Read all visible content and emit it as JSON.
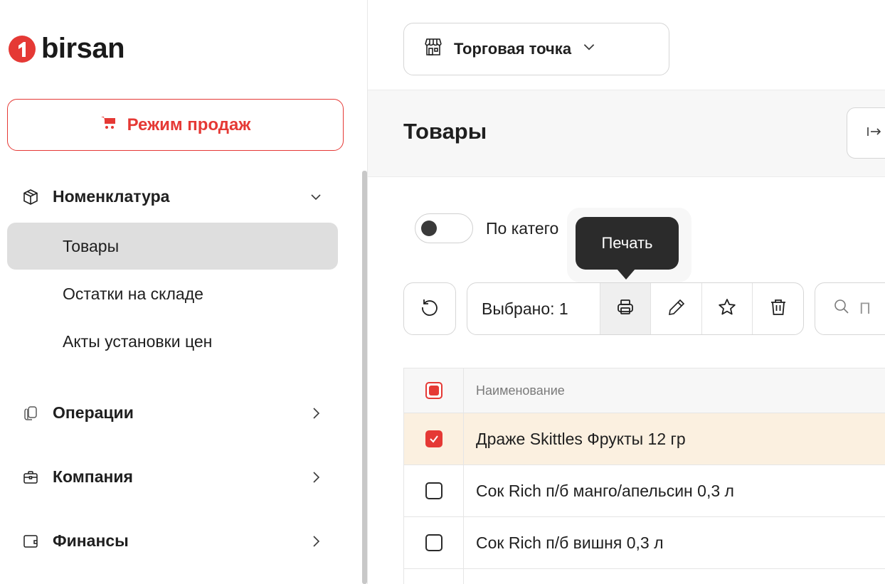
{
  "brand": {
    "name": "birsan",
    "accent": "#e53935"
  },
  "sidebar": {
    "sales_mode_label": "Режим продаж",
    "sections": [
      {
        "label": "Номенклатура",
        "icon": "box-icon",
        "expanded": true
      },
      {
        "label": "Операции",
        "icon": "copy-icon",
        "expanded": false
      },
      {
        "label": "Компания",
        "icon": "briefcase-icon",
        "expanded": false
      },
      {
        "label": "Финансы",
        "icon": "wallet-icon",
        "expanded": false
      }
    ],
    "sub_items": [
      {
        "label": "Товары",
        "active": true
      },
      {
        "label": "Остатки на складе",
        "active": false
      },
      {
        "label": "Акты установки цен",
        "active": false
      }
    ]
  },
  "topbar": {
    "store_select_label": "Торговая точка"
  },
  "page": {
    "title": "Товары"
  },
  "filters": {
    "by_category_label": "По катего",
    "by_category_on": false
  },
  "tooltip": {
    "text": "Печать"
  },
  "toolbar": {
    "selected_text": "Выбрано: 1",
    "actions": [
      "print-icon",
      "edit-icon",
      "star-icon",
      "trash-icon"
    ],
    "search_placeholder": "П"
  },
  "table": {
    "columns": [
      "Наименование"
    ],
    "rows": [
      {
        "name": "Драже Skittles Фрукты 12 гр",
        "checked": true
      },
      {
        "name": "Сок Rich п/б манго/апельсин 0,3 л",
        "checked": false
      },
      {
        "name": "Сок Rich п/б вишня 0,3 л",
        "checked": false
      }
    ]
  }
}
